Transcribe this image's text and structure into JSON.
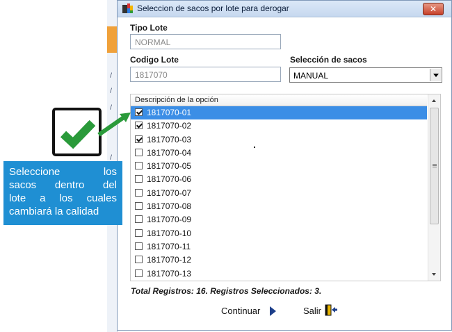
{
  "window": {
    "title": "Seleccion de sacos por lote para derogar",
    "close_label": "✕"
  },
  "form": {
    "tipo_lote_label": "Tipo Lote",
    "tipo_lote_value": "NORMAL",
    "codigo_lote_label": "Codigo Lote",
    "codigo_lote_value": "1817070",
    "seleccion_label": "Selección de sacos",
    "seleccion_value": "MANUAL"
  },
  "list": {
    "column_header": "Descripción de la opción",
    "items": [
      {
        "code": "1817070-01",
        "checked": true,
        "selected": true
      },
      {
        "code": "1817070-02",
        "checked": true,
        "selected": false
      },
      {
        "code": "1817070-03",
        "checked": true,
        "selected": false
      },
      {
        "code": "1817070-04",
        "checked": false,
        "selected": false
      },
      {
        "code": "1817070-05",
        "checked": false,
        "selected": false
      },
      {
        "code": "1817070-06",
        "checked": false,
        "selected": false
      },
      {
        "code": "1817070-07",
        "checked": false,
        "selected": false
      },
      {
        "code": "1817070-08",
        "checked": false,
        "selected": false
      },
      {
        "code": "1817070-09",
        "checked": false,
        "selected": false
      },
      {
        "code": "1817070-10",
        "checked": false,
        "selected": false
      },
      {
        "code": "1817070-11",
        "checked": false,
        "selected": false
      },
      {
        "code": "1817070-12",
        "checked": false,
        "selected": false
      },
      {
        "code": "1817070-13",
        "checked": false,
        "selected": false
      }
    ]
  },
  "footer": {
    "totals": "Total Registros: 16. Registros Seleccionados: 3.",
    "continue_label": "Continuar",
    "exit_label": "Salir"
  },
  "callout": {
    "lines": [
      "Seleccione los",
      "sacos dentro del",
      "lote a los cuales",
      "cambiará la calidad"
    ]
  },
  "colors": {
    "selection": "#3b8ee6",
    "callout_bg": "#1f8fd3",
    "check_green": "#2a9a3a"
  }
}
